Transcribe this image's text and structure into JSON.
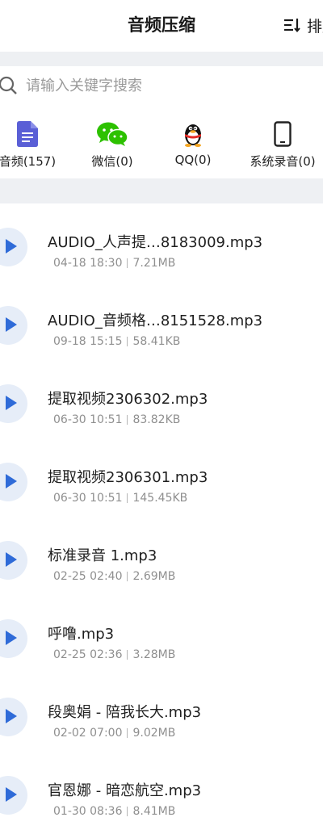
{
  "header": {
    "title": "音频压缩",
    "sort_label": "排序"
  },
  "search": {
    "placeholder": "请输入关键字搜索"
  },
  "categories": [
    {
      "label": "音频(157)",
      "icon": "audio-file-icon"
    },
    {
      "label": "微信(0)",
      "icon": "wechat-icon"
    },
    {
      "label": "QQ(0)",
      "icon": "qq-penguin-icon"
    },
    {
      "label": "系统录音(0)",
      "icon": "phone-icon"
    }
  ],
  "files": [
    {
      "name": "AUDIO_人声提…8183009.mp3",
      "date": "04-18 18:30",
      "size": "7.21MB"
    },
    {
      "name": "AUDIO_音频格…8151528.mp3",
      "date": "09-18 15:15",
      "size": "58.41KB"
    },
    {
      "name": "提取视频2306302.mp3",
      "date": "06-30 10:51",
      "size": "83.82KB"
    },
    {
      "name": "提取视频2306301.mp3",
      "date": "06-30 10:51",
      "size": "145.45KB"
    },
    {
      "name": "标准录音 1.mp3",
      "date": "02-25 02:40",
      "size": "2.69MB"
    },
    {
      "name": "呼噜.mp3",
      "date": "02-25 02:36",
      "size": "3.28MB"
    },
    {
      "name": "段奥娟 - 陪我长大.mp3",
      "date": "02-02 07:00",
      "size": "9.02MB"
    },
    {
      "name": "官恩娜 - 暗恋航空.mp3",
      "date": "01-30 08:36",
      "size": "8.41MB"
    }
  ],
  "colors": {
    "accent": "#2f6bd8",
    "play_bg": "#e6edf8",
    "wechat": "#2dc100",
    "audio": "#5a5fd6"
  }
}
